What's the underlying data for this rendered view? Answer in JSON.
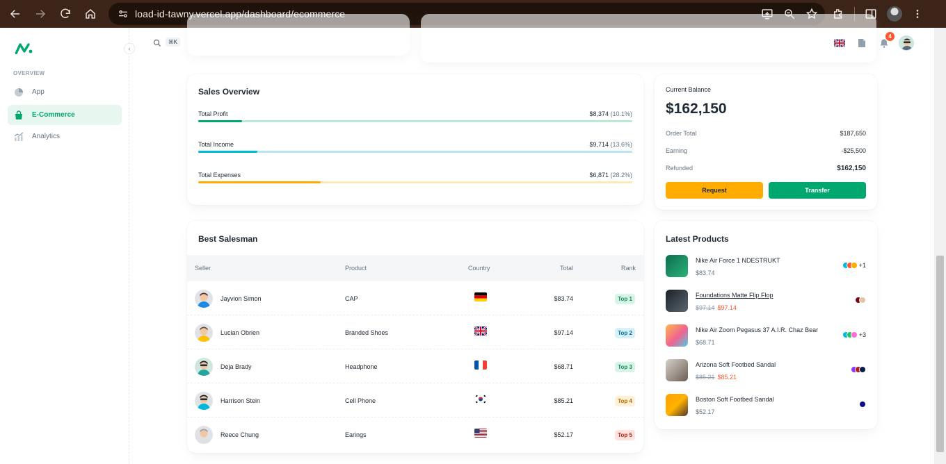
{
  "browser": {
    "url": "load-id-tawny.vercel.app/dashboard/ecommerce"
  },
  "sidebar": {
    "subheader": "OVERVIEW",
    "items": [
      {
        "label": "App"
      },
      {
        "label": "E-Commerce"
      },
      {
        "label": "Analytics"
      }
    ]
  },
  "topbar": {
    "shortcut": "⌘K",
    "notification_count": "4"
  },
  "sales_overview": {
    "title": "Sales Overview",
    "rows": [
      {
        "label": "Total Profit",
        "value": "$8,374",
        "percent": "(10.1%)",
        "fill": 0.101,
        "color": "#00a76f",
        "track": "#bce8d6"
      },
      {
        "label": "Total Income",
        "value": "$9,714",
        "percent": "(13.6%)",
        "fill": 0.136,
        "color": "#00b8d9",
        "track": "#b8e6f0"
      },
      {
        "label": "Total Expenses",
        "value": "$6,871",
        "percent": "(28.2%)",
        "fill": 0.282,
        "color": "#ffab00",
        "track": "#fde9b8"
      }
    ]
  },
  "balance": {
    "label": "Current Balance",
    "amount": "$162,150",
    "rows": [
      {
        "label": "Order Total",
        "value": "$187,650"
      },
      {
        "label": "Earning",
        "value": "-$25,500"
      },
      {
        "label": "Refunded",
        "value": "$162,150"
      }
    ],
    "request_label": "Request",
    "transfer_label": "Transfer"
  },
  "best_salesman": {
    "title": "Best Salesman",
    "headers": {
      "seller": "Seller",
      "product": "Product",
      "country": "Country",
      "total": "Total",
      "rank": "Rank"
    },
    "rows": [
      {
        "seller": "Jayvion Simon",
        "product": "CAP",
        "country": "de",
        "total": "$83.74",
        "rank": "Top 1",
        "rank_color": "#118d57",
        "rank_bg": "#d8f3e8"
      },
      {
        "seller": "Lucian Obrien",
        "product": "Branded Shoes",
        "country": "gb",
        "total": "$97.14",
        "rank": "Top 2",
        "rank_color": "#006c9c",
        "rank_bg": "#d6f1f9"
      },
      {
        "seller": "Deja Brady",
        "product": "Headphone",
        "country": "fr",
        "total": "$68.71",
        "rank": "Top 3",
        "rank_color": "#118d57",
        "rank_bg": "#d8f3e8"
      },
      {
        "seller": "Harrison Stein",
        "product": "Cell Phone",
        "country": "kr",
        "total": "$85.21",
        "rank": "Top 4",
        "rank_color": "#b76e00",
        "rank_bg": "#fff1d6"
      },
      {
        "seller": "Reece Chung",
        "product": "Earings",
        "country": "us",
        "total": "$52.17",
        "rank": "Top 5",
        "rank_color": "#b71d18",
        "rank_bg": "#ffe4de"
      }
    ]
  },
  "latest_products": {
    "title": "Latest Products",
    "items": [
      {
        "name": "Nike Air Force 1 NDESTRUKT",
        "price": "$83.74",
        "old_price": "",
        "colors": [
          "#00b8d9",
          "#ff5630",
          "#ffab00"
        ],
        "more": "+1"
      },
      {
        "name": "Foundations Matte Flip Flop",
        "price": "$97.14",
        "old_price": "$97.14",
        "colors": [
          "#7a0916",
          "#e0c6a8"
        ],
        "more": ""
      },
      {
        "name": "Nike Air Zoom Pegasus 37 A.I.R. Chaz Bear",
        "price": "$68.71",
        "old_price": "",
        "colors": [
          "#00b8d9",
          "#22c55e",
          "#ff6cd9"
        ],
        "more": "+3"
      },
      {
        "name": "Arizona Soft Footbed Sandal",
        "price": "$85.21",
        "old_price": "$85.21",
        "colors": [
          "#8e33ff",
          "#b71d18",
          "#0c1a4b"
        ],
        "more": ""
      },
      {
        "name": "Boston Soft Footbed Sandal",
        "price": "$52.17",
        "old_price": "",
        "colors": [
          "#0c0c8a"
        ],
        "more": ""
      }
    ]
  }
}
